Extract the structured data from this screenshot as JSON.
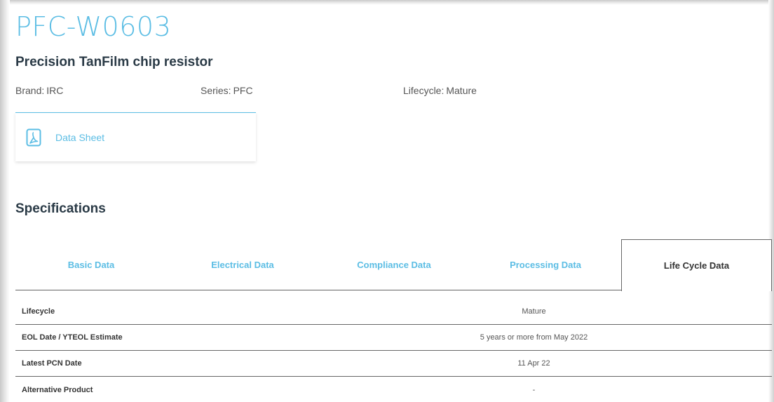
{
  "product": {
    "code": "PFC-W0603",
    "description": "Precision TanFilm chip resistor",
    "brand_label": "Brand:",
    "brand_value": "IRC",
    "series_label": "Series:",
    "series_value": "PFC",
    "lifecycle_label": "Lifecycle:",
    "lifecycle_value": "Mature"
  },
  "documents": {
    "icon": "pdf-icon",
    "datasheet_label": "Data Sheet"
  },
  "specifications": {
    "title": "Specifications",
    "tabs": [
      {
        "label": "Basic Data",
        "active": false
      },
      {
        "label": "Electrical Data",
        "active": false
      },
      {
        "label": "Compliance Data",
        "active": false
      },
      {
        "label": "Processing Data",
        "active": false
      },
      {
        "label": "Life Cycle Data",
        "active": true
      }
    ],
    "rows": [
      {
        "key": "Lifecycle",
        "value": "Mature"
      },
      {
        "key": "EOL Date / YTEOL Estimate",
        "value": "5 years or more from May 2022"
      },
      {
        "key": "Latest PCN Date",
        "value": "11 Apr 22"
      },
      {
        "key": "Alternative Product",
        "value": "-"
      }
    ]
  },
  "colors": {
    "accent": "#5bbde4",
    "heading": "#2a3a46",
    "divider": "#666666"
  }
}
